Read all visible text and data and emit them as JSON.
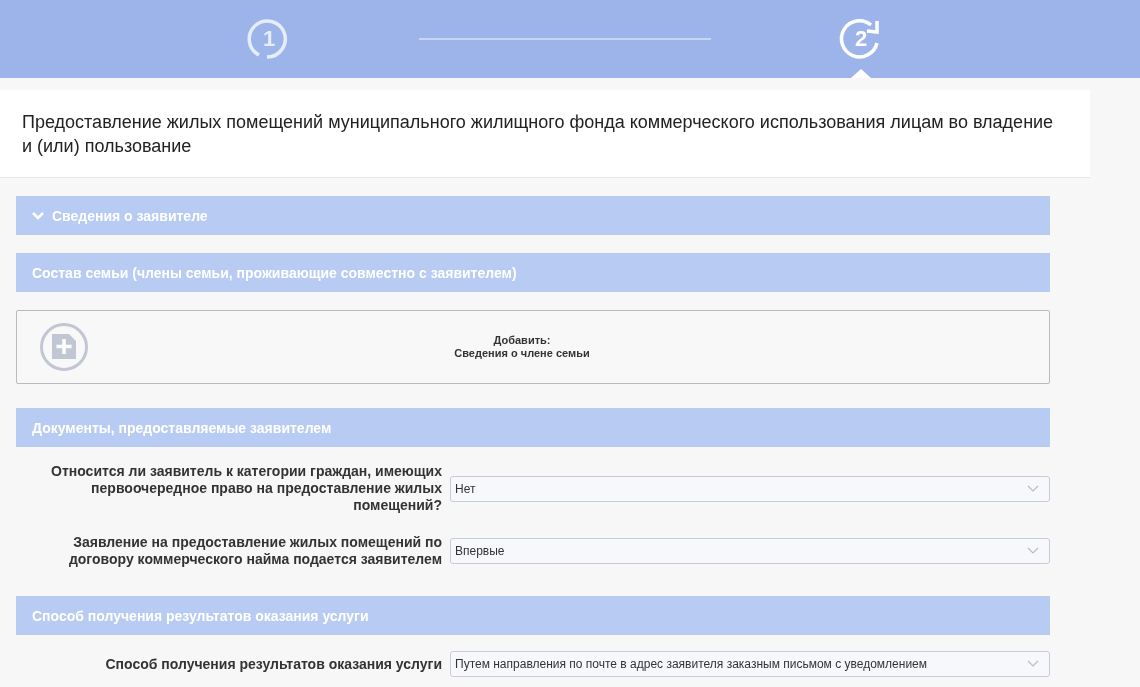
{
  "steps": [
    {
      "number": "1",
      "selected": false
    },
    {
      "number": "2",
      "selected": true
    }
  ],
  "title": "Предоставление жилых помещений муниципального жилищного фонда коммерческого использования лицам во владение и (или) пользование",
  "sections": [
    {
      "kind": "collapsible",
      "title": "Сведения о заявителе",
      "expanded": true
    },
    {
      "kind": "add",
      "title": "Состав семьи (члены семьи, проживающие совместно с заявителем)",
      "add_label": "Добавить:",
      "add_sublabel": "Сведения о члене семьи"
    },
    {
      "kind": "fields",
      "title": "Документы, предоставляемые заявителем",
      "fields": [
        {
          "label": "Относится ли заявитель к категории граждан, имеющих первоочередное право на предоставление жилых помещений?",
          "value": "Нет"
        },
        {
          "label": "Заявление на предоставление жилых помещений по договору коммерческого найма подается заявителем",
          "value": "Впервые"
        }
      ]
    },
    {
      "kind": "fields",
      "title": "Способ получения результатов оказания услуги",
      "fields": [
        {
          "label": "Способ получения результатов оказания услуги",
          "value": "Путем направления по почте в адрес заявителя заказным письмом с уведомлением"
        }
      ]
    }
  ]
}
